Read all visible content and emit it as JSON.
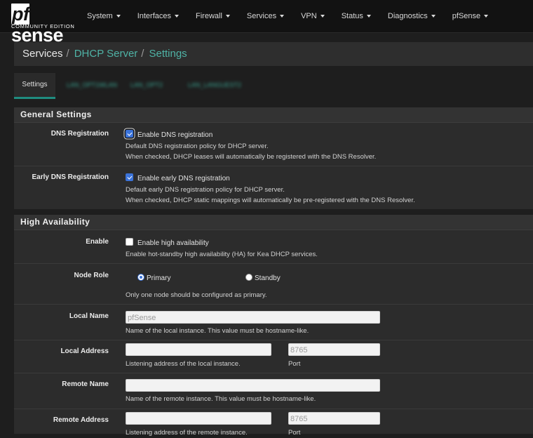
{
  "brand": {
    "logo": "sense",
    "logo_prefix": "pf",
    "subtitle": "COMMUNITY EDITION"
  },
  "nav": [
    "System",
    "Interfaces",
    "Firewall",
    "Services",
    "VPN",
    "Status",
    "Diagnostics",
    "pfSense"
  ],
  "breadcrumb": {
    "root": "Services",
    "section": "DHCP Server",
    "page": "Settings",
    "sep": "/"
  },
  "tabs": {
    "active": "Settings",
    "t1": "LAN_OPT1WLAN",
    "t2": "LAN_OPT2",
    "t3": "LAN_LANGUEST2"
  },
  "general": {
    "title": "General Settings",
    "dns": {
      "label": "DNS Registration",
      "checkbox": "Enable DNS registration",
      "help1": "Default DNS registration policy for DHCP server.",
      "help2": "When checked, DHCP leases will automatically be registered with the DNS Resolver."
    },
    "early": {
      "label": "Early DNS Registration",
      "checkbox": "Enable early DNS registration",
      "help1": "Default early DNS registration policy for DHCP server.",
      "help2": "When checked, DHCP static mappings will automatically be pre-registered with the DNS Resolver."
    }
  },
  "ha": {
    "title": "High Availability",
    "enable": {
      "label": "Enable",
      "checkbox": "Enable high availability",
      "help": "Enable hot-standby high availability (HA) for Kea DHCP services."
    },
    "role": {
      "label": "Node Role",
      "primary": "Primary",
      "standby": "Standby",
      "help": "Only one node should be configured as primary."
    },
    "local_name": {
      "label": "Local Name",
      "placeholder": "pfSense",
      "help": "Name of the local instance. This value must be hostname-like."
    },
    "local_address": {
      "label": "Local Address",
      "value": "",
      "port_placeholder": "8765",
      "help": "Listening address of the local instance.",
      "port_help": "Port"
    },
    "remote_name": {
      "label": "Remote Name",
      "value": "",
      "help": "Name of the remote instance. This value must be hostname-like."
    },
    "remote_address": {
      "label": "Remote Address",
      "value": "",
      "port_placeholder": "8765",
      "help": "Listening address of the remote instance.",
      "port_help": "Port"
    }
  },
  "colors": {
    "accent": "#4fb3a6",
    "tab_underline": "#1f8c80",
    "checkbox": "#3b73d9"
  }
}
